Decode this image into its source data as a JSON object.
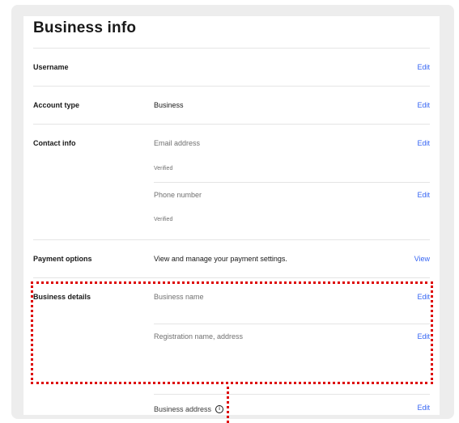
{
  "page": {
    "title": "Business info"
  },
  "rows": {
    "username": {
      "label": "Username",
      "action": "Edit"
    },
    "account_type": {
      "label": "Account type",
      "value": "Business",
      "action": "Edit"
    },
    "contact_info": {
      "label": "Contact info",
      "email_label": "Email address",
      "email_status": "Verified",
      "email_action": "Edit",
      "phone_label": "Phone number",
      "phone_status": "Verified",
      "phone_action": "Edit"
    },
    "payment_options": {
      "label": "Payment options",
      "value": "View and manage your payment settings.",
      "action": "View"
    },
    "business_details": {
      "label": "Business details",
      "name_label": "Business name",
      "name_action": "Edit",
      "registration_label": "Registration name, address",
      "registration_action": "Edit",
      "address_label": "Business address",
      "address_action": "Edit"
    }
  },
  "annotation": {
    "highlight_color": "#dd0000"
  },
  "colors": {
    "link": "#3665f3",
    "divider": "#e5e5e5",
    "frame": "#ededed"
  }
}
